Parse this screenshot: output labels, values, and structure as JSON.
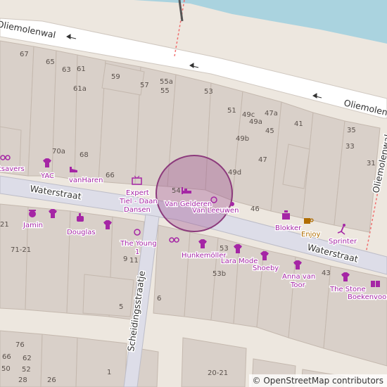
{
  "attribution": "© OpenStreetMap contributors",
  "colors": {
    "building": "#d9d0c9",
    "building_stroke": "#c4b8ae",
    "background": "#ede7df",
    "water": "#aad3df",
    "road": "#ffffff",
    "pedestrian": "#dddde8",
    "poi": "#a526a5",
    "poi_food": "#b06d00",
    "marker_fill": "#9c4a8c",
    "railway_dash": "#f06e6e"
  },
  "streets": {
    "oliemolenwal_left": "Oliemolenwal",
    "oliemolenwal_right": "Oliemolenwal",
    "oliemolenwal_far_right": "Oliemolenwal",
    "waterstraat_left": "Waterstraat",
    "waterstraat_right": "Waterstraat",
    "scheidingsstraatje": "Scheidingsstraatje"
  },
  "house_numbers": {
    "n67": "67",
    "n65": "65",
    "n63": "63",
    "n61": "61",
    "n61a": "61a",
    "n59": "59",
    "n57": "57",
    "n55a": "55a",
    "n55": "55",
    "n53": "53",
    "n51": "51",
    "n49c": "49c",
    "n49a": "49a",
    "n47a": "47a",
    "n45": "45",
    "n41": "41",
    "n35": "35",
    "n33": "33",
    "n31": "31",
    "n49b": "49b",
    "n47": "47",
    "n49d": "49d",
    "n70a": "70a",
    "n68": "68",
    "n66": "66",
    "n54": "54",
    "n46": "46",
    "n21": "21",
    "n71_21": "71-21",
    "n9": "9",
    "n11": "11",
    "n53s": "53",
    "n53b": "53b",
    "n43": "43",
    "n6": "6",
    "n5": "5",
    "n76": "76",
    "n66s": "66",
    "n62": "62",
    "n50": "50",
    "n52": "52",
    "n28": "28",
    "n26": "26",
    "n1": "1",
    "n20_21": "20-21"
  },
  "pois": {
    "eyesavers": "tsavers",
    "yac": "YAC",
    "vanharen": "vanHaren",
    "expert_1": "Expert",
    "expert_2": "Tiel - Daan",
    "expert_3": "Dansen",
    "vangelderen": "Van Gelderen",
    "vanleeuwen": "Van Leeuwen",
    "blokker": "Blokker",
    "enjoy": "Enjoy",
    "sprinter": "Sprinter",
    "jamin": "Jamin",
    "douglas": "Douglas",
    "theyoung_1": "The Young",
    "theyoung_2": "1",
    "hunkemoller": "Hunkemöller",
    "laramode": "Lara Mode",
    "shoeby": "Shoeby",
    "annavantoor_1": "Anna van",
    "annavantoor_2": "Toor",
    "thestone": "The Stone",
    "boekenvoordeel": "Boekenvoor"
  },
  "icons": [
    "glasses-icon",
    "shirt-icon",
    "shoe-icon",
    "tv-icon",
    "bed-icon",
    "ring-icon",
    "houseware-icon",
    "coffee-icon",
    "runner-icon",
    "confectionery-icon",
    "perfume-icon",
    "book-icon"
  ]
}
